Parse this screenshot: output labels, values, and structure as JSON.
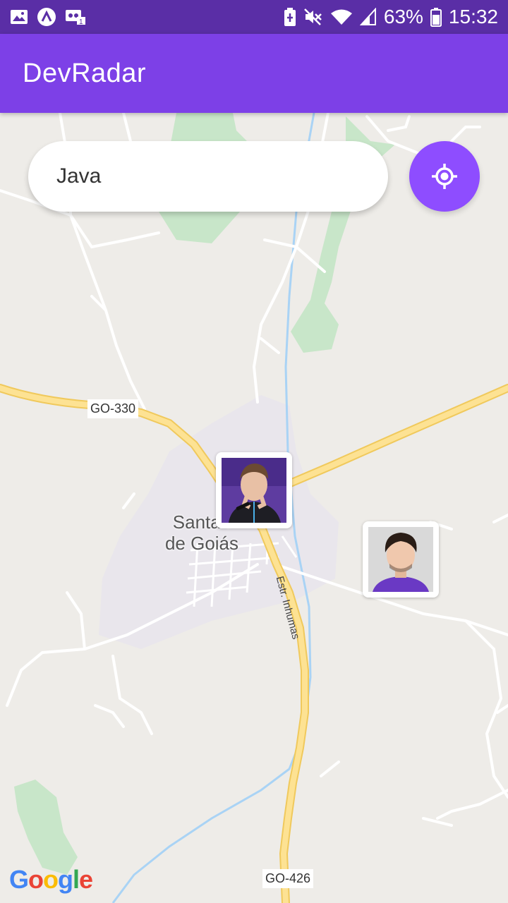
{
  "status_bar": {
    "battery": "63%",
    "time": "15:32",
    "icons": [
      "image-icon",
      "accessibility-icon",
      "voicemail-icon",
      "battery-saver-icon",
      "mute-icon",
      "wifi-icon",
      "signal-icon",
      "battery-icon"
    ]
  },
  "app_bar": {
    "title": "DevRadar"
  },
  "search": {
    "value": "Java",
    "placeholder": ""
  },
  "map": {
    "road_labels": {
      "go330": "GO-330",
      "go426": "GO-426",
      "estr": "Estr. Inhumas"
    },
    "town_label": {
      "line1": "Santa I",
      "line2": "de Goiás"
    },
    "markers": [
      {
        "name": "developer-marker-1",
        "avatar_bg": "#5e3ca0"
      },
      {
        "name": "developer-marker-2",
        "avatar_bg": "#d9d9d9"
      }
    ],
    "attribution": "Google"
  },
  "colors": {
    "primary": "#7d40e7",
    "status_bar": "#5a2ea6",
    "locate_button": "#8e4dff",
    "highway": "#fde293",
    "highway_border": "#f0c95c",
    "water": "#a9d3f5",
    "park": "#c8e6c9"
  }
}
